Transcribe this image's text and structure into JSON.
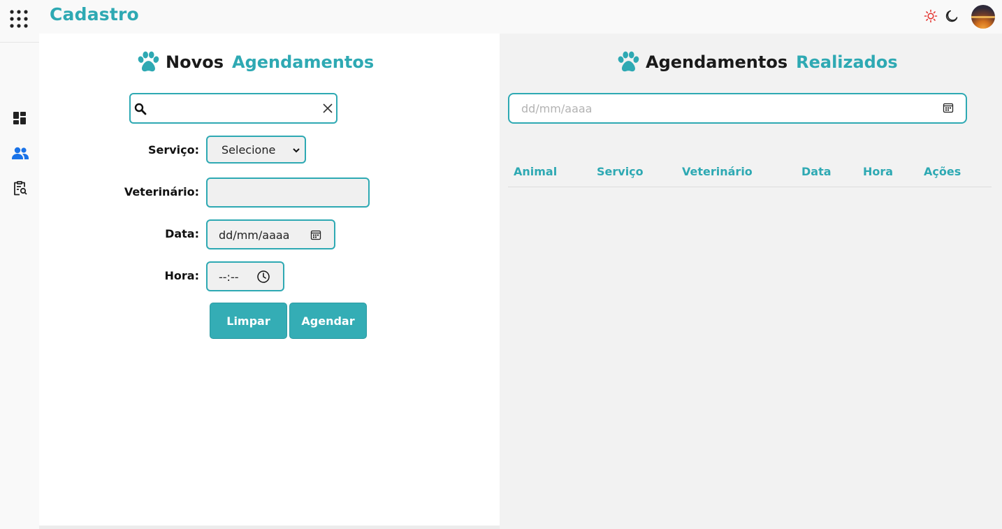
{
  "header": {
    "brand": "Cadastro",
    "icons": {
      "apps": "apps-grid-icon",
      "light": "sun-icon",
      "dark": "moon-icon",
      "avatar": "user-avatar"
    }
  },
  "sidebar": {
    "items": [
      {
        "name": "dashboard",
        "icon": "dashboard-icon",
        "active": false
      },
      {
        "name": "users",
        "icon": "users-icon",
        "active": true
      },
      {
        "name": "clipboard-search",
        "icon": "clipboard-search-icon",
        "active": false
      }
    ]
  },
  "new_appointments": {
    "title_part1": "Novos",
    "title_part2": "Agendamentos",
    "search": {
      "value": "",
      "placeholder": ""
    },
    "form": {
      "service_label": "Serviço:",
      "service_value": "Selecione",
      "vet_label": "Veterinário:",
      "vet_value": "",
      "date_label": "Data:",
      "date_placeholder": "dd/mm/aaaa",
      "time_label": "Hora:",
      "time_placeholder": "--:--"
    },
    "buttons": {
      "clear": "Limpar",
      "schedule": "Agendar"
    }
  },
  "done_appointments": {
    "title_part1": "Agendamentos",
    "title_part2": "Realizados",
    "date_filter_placeholder": "dd/mm/aaaa",
    "columns": [
      "Animal",
      "Serviço",
      "Veterinário",
      "Data",
      "Hora",
      "Ações"
    ],
    "rows": []
  },
  "colors": {
    "accent": "#2ea9b3",
    "button": "#34adb5",
    "sidebar_active": "#1a73e8",
    "sun": "#e53935"
  }
}
